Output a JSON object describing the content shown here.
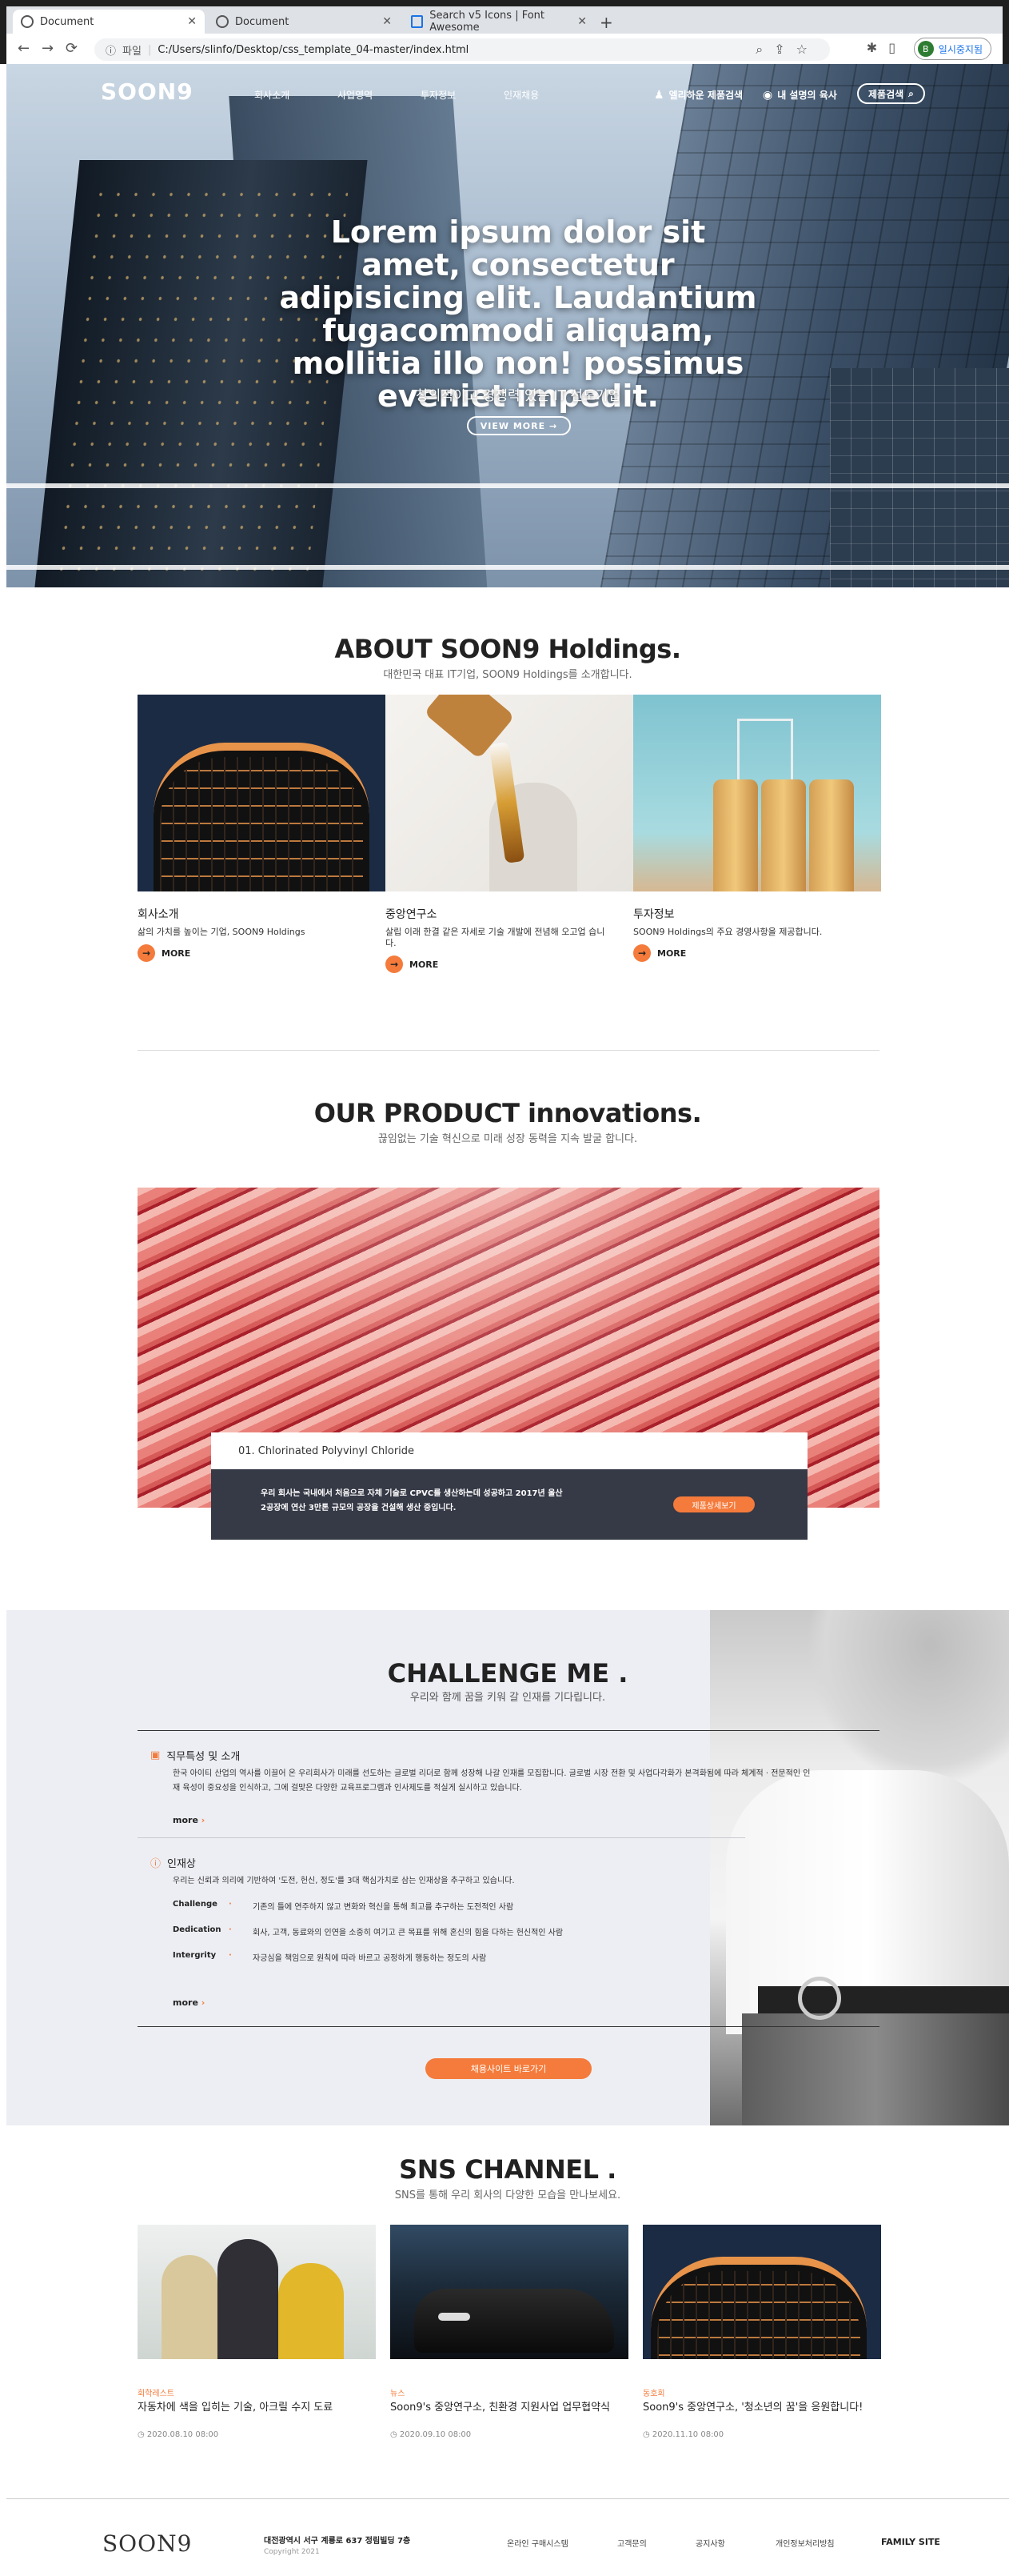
{
  "browser": {
    "tabs": [
      {
        "label": "Document",
        "active": true
      },
      {
        "label": "Document",
        "active": false
      },
      {
        "label": "Search v5 Icons | Font Awesome",
        "active": false
      }
    ],
    "new_tab": "+",
    "url_prefix": "파일",
    "url": "C:/Users/slinfo/Desktop/css_template_04-master/index.html",
    "pause_button": "일시중지됨",
    "avatar_initial": "B"
  },
  "nav": {
    "logo": "SOON9",
    "menu": [
      "회사소개",
      "사업영역",
      "투자정보",
      "인재채용"
    ],
    "util_1": "엘리하운 제품검색",
    "util_2": "내 설명의 육사",
    "search_label": "제품검색"
  },
  "hero": {
    "title": "Lorem ipsum dolor sit amet, consectetur adipisicing elit. Laudantium fugacommodi aliquam, mollitia illo non! possimus eveniet impedit.",
    "subtitle": "창의적이고 경쟁력 있는 IT 선도기업",
    "button": "VIEW MORE →"
  },
  "about": {
    "title": "ABOUT SOON9 Holdings.",
    "subtitle": "대한민국 대표 IT기업, SOON9 Holdings를 소개합니다.",
    "cards": [
      {
        "title": "회사소개",
        "desc": "삶의 가치를 높이는 기업, SOON9 Holdings",
        "more": "MORE"
      },
      {
        "title": "중앙연구소",
        "desc": "살립 이래 한결 같은 자세로 기술 개발에 전념해 오고업 습니다.",
        "more": "MORE"
      },
      {
        "title": "투자정보",
        "desc": "SOON9 Holdings의 주요 경영사항을 제공합니다.",
        "more": "MORE"
      }
    ]
  },
  "product": {
    "title": "OUR PRODUCT innovations.",
    "subtitle": "끊임없는 기술 혁신으로 미래 성장 동력을 지속 발굴 합니다.",
    "item_name": "01. Chlorinated Polyvinyl Chloride",
    "item_desc": "우리 회사는 국내에서 처음으로 자체 기술로 CPVC를 생산하는데 성공하고 2017년 울산 2공장에 연산 3만톤 규모의 공장을 건설해 생산 중입니다.",
    "item_button": "제품상세보기"
  },
  "challenge": {
    "title": "CHALLENGE ME .",
    "subtitle": "우리와 함께 꿈을 키워 갈 인재를 기다립니다.",
    "section1_title": "직무특성 및 소개",
    "section1_text": "한국 아이티 산업의 역사를 이끌어 온 우리회사가 미래를 선도하는 글로벌 리더로 함께 성장해 나갈 인재를 모집합니다. 글로벌 시장 전환 및 사업다각화가 본격화됨에 따라 체계적 · 전문적인 인재 육성이 중요성을 인식하고, 그에 걸맞은 다양한 교육프로그램과 인사제도를 적실게 실시하고 있습니다.",
    "section1_more": "more",
    "section2_title": "인재상",
    "section2_text": "우리는 신뢰과 의리에 기반하여 '도전, 헌신, 정도'를 3대 핵심가치로 삼는 인재상을 추구하고 있습니다.",
    "values": [
      {
        "key": "Challenge",
        "text": "기존의 틀에 연주하지 않고 변화와 혁신을 통해 최고를 추구하는 도전적인 사람"
      },
      {
        "key": "Dedication",
        "text": "회사, 고객, 동료와의 인연을 소중히 여기고 큰 목표를 위해 혼신의 힘을 다하는 헌신적인 사람"
      },
      {
        "key": "Intergrity",
        "text": "자긍심을 책임으로 원칙에 따라 바르고 공정하게 행동하는 정도의 사람"
      }
    ],
    "section2_more": "more",
    "button": "채용사이트 바로가기"
  },
  "sns": {
    "title": "SNS CHANNEL .",
    "subtitle": "SNS를 통해 우리 회사의 다양한 모습을 만나보세요.",
    "cards": [
      {
        "category": "회학레스트",
        "title": "자동차에 색을 입히는 기술, 아크릴 수지 도료",
        "date": "2020.08.10 08:00"
      },
      {
        "category": "뉴스",
        "title": "Soon9's 중앙연구소, 친환경 지원사업 업무협약식",
        "date": "2020.09.10 08:00"
      },
      {
        "category": "동호회",
        "title": "Soon9's 중앙연구소, '청소년의 꿈'을 응원합니다!",
        "date": "2020.11.10 08:00"
      }
    ]
  },
  "footer": {
    "logo": "SOON9",
    "address": "대전광역시 서구 계룡로 637 정림빌딩 7층",
    "copyright": "Copyright 2021",
    "links": [
      "온라인 구매시스템",
      "고객문의",
      "공지사항",
      "개인정보처리방침"
    ],
    "family_site": "FAMILY SITE"
  },
  "colors": {
    "accent": "#f47b3b",
    "dark_panel": "#363946",
    "challenge_bg": "#edeef3"
  }
}
